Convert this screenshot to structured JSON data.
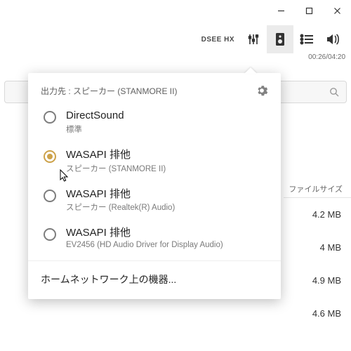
{
  "window": {
    "min": "–",
    "max": "□",
    "close": "×"
  },
  "toolbar": {
    "dsee": "DSEE HX",
    "time": "00:26/04:20"
  },
  "search": {
    "icon": "🔍"
  },
  "rightcol": {
    "header": "ファイルサイズ",
    "rows": [
      "4.2 MB",
      "4 MB",
      "4.9 MB",
      "4.6 MB"
    ]
  },
  "popup": {
    "title": "出力先 : スピーカー (STANMORE II)",
    "options": [
      {
        "main": "DirectSound",
        "sub": "標準",
        "selected": false
      },
      {
        "main": "WASAPI 排他",
        "sub": "スピーカー (STANMORE II)",
        "selected": true
      },
      {
        "main": "WASAPI 排他",
        "sub": "スピーカー (Realtek(R) Audio)",
        "selected": false
      },
      {
        "main": "WASAPI 排他",
        "sub": "EV2456 (HD Audio Driver for Display Audio)",
        "selected": false
      }
    ],
    "home": "ホームネットワーク上の機器..."
  }
}
